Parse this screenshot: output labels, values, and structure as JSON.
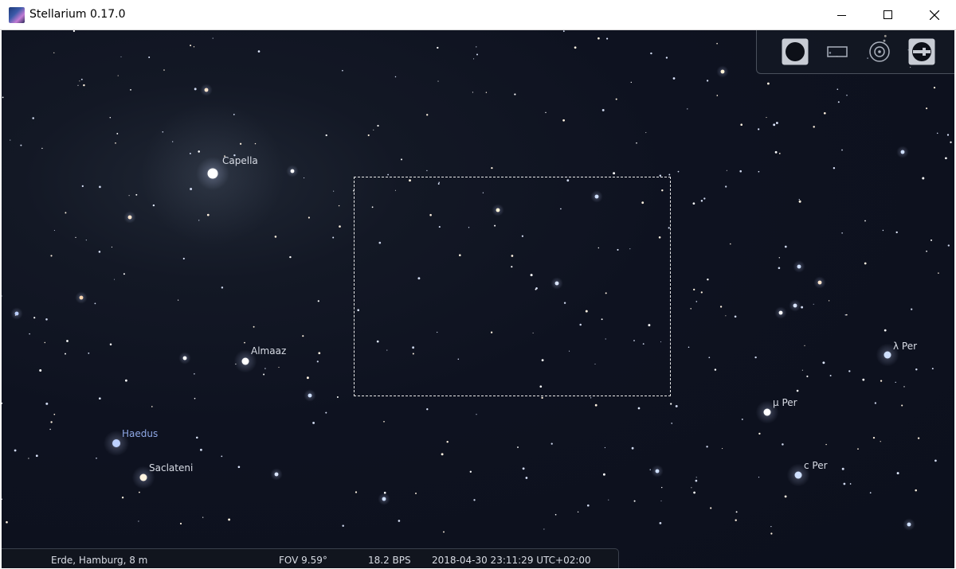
{
  "window": {
    "title": "Stellarium 0.17.0",
    "controls": [
      "minimize",
      "maximize",
      "close"
    ]
  },
  "sky": {
    "labels": {
      "capella": "Capella",
      "almaaz": "Almaaz",
      "haedus": "Haedus",
      "saclateni": "Saclateni",
      "mu_per": "μ Per",
      "lambda_per": "λ Per",
      "c_per": "c Per"
    }
  },
  "toolbar": {
    "icons": [
      "filled-circle-icon",
      "rectangle-icon",
      "target-circle-icon",
      "ocular-telescope-icon"
    ]
  },
  "status": {
    "location": "Erde, Hamburg, 8 m",
    "fov": "FOV 9.59°",
    "fps": "18.2 BPS",
    "datetime": "2018-04-30 23:11:29 UTC+02:00"
  },
  "colors": {
    "sky": "#0e1220",
    "label": "#d9dde6",
    "label_blue": "#8fa8e6"
  }
}
